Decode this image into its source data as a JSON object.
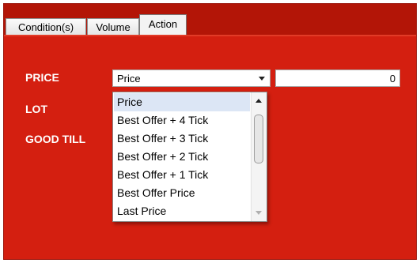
{
  "tabs": [
    {
      "label": "Condition(s)",
      "active": false
    },
    {
      "label": "Volume",
      "active": false
    },
    {
      "label": "Action",
      "active": true
    }
  ],
  "form": {
    "price_label": "PRICE",
    "lot_label": "LOT",
    "good_till_label": "GOOD TILL",
    "price_select_value": "Price",
    "price_input_value": "0"
  },
  "dropdown": {
    "options": [
      "Price",
      "Best Offer  + 4 Tick",
      "Best Offer  + 3 Tick",
      "Best Offer  + 2 Tick",
      "Best Offer  + 1 Tick",
      "Best Offer Price",
      "Last Price"
    ],
    "highlighted_index": 0
  },
  "colors": {
    "panel_background": "#d41f10",
    "tab_strip": "#b31507",
    "highlight": "#dce6f5"
  }
}
